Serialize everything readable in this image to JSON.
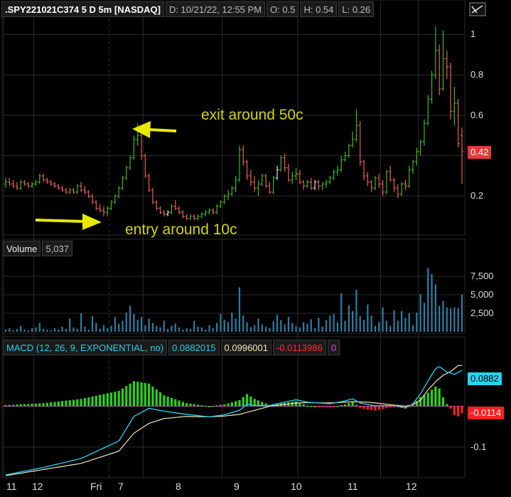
{
  "header": {
    "symbol": ".SPY221021C374 5 D 5m [NASDAQ]",
    "date": "D: 10/21/22, 12:55 PM",
    "open": "O: 0.5",
    "high": "H: 0.54",
    "low": "L: 0.26"
  },
  "annotations": {
    "exit": "exit around 50c",
    "entry": "entry around 10c"
  },
  "price_tag": "0.42",
  "volume_header": {
    "label": "Volume",
    "value": "5,037"
  },
  "macd_header": {
    "label": "MACD (12, 26, 9, EXPONENTIAL, no)",
    "value": "0.0882015",
    "avg": "0.0996001",
    "diff": "-0.0113986",
    "extra": "0"
  },
  "macd_tags": {
    "value": "0.0882",
    "diff": "-0.0114"
  },
  "colors": {
    "up": "#3fb81c",
    "down": "#e5605a",
    "neutral": "#e0e0e0",
    "volume": "#2f7ea3",
    "macd": "#28c8e6",
    "avg": "#f5e6b0",
    "hist_up": "#2cd11e",
    "hist_down": "#ff2020",
    "annotation": "#d4d400",
    "grid": "#2d2d2d",
    "tag_value": "#28d3ee",
    "tag_diff": "#ff2020"
  },
  "x_axis": {
    "ticks": [
      "11",
      "12",
      "Fri",
      "7",
      "8",
      "9",
      "10",
      "11",
      "12"
    ]
  },
  "chart_data": [
    {
      "type": "candlestick",
      "title": ".SPY221021C374 5 D 5m [NASDAQ]",
      "yticks": [
        0.2,
        0.4,
        0.6,
        0.8,
        1.0
      ],
      "ylim": [
        0.05,
        1.1
      ],
      "ohlc": [
        [
          0.26,
          0.29,
          0.24,
          0.27
        ],
        [
          0.27,
          0.29,
          0.25,
          0.26
        ],
        [
          0.26,
          0.28,
          0.24,
          0.25
        ],
        [
          0.25,
          0.27,
          0.23,
          0.24
        ],
        [
          0.24,
          0.28,
          0.23,
          0.27
        ],
        [
          0.27,
          0.28,
          0.25,
          0.26
        ],
        [
          0.26,
          0.27,
          0.24,
          0.25
        ],
        [
          0.25,
          0.27,
          0.24,
          0.26
        ],
        [
          0.26,
          0.28,
          0.25,
          0.27
        ],
        [
          0.27,
          0.31,
          0.26,
          0.3
        ],
        [
          0.3,
          0.31,
          0.27,
          0.28
        ],
        [
          0.28,
          0.29,
          0.26,
          0.27
        ],
        [
          0.27,
          0.28,
          0.25,
          0.26
        ],
        [
          0.26,
          0.27,
          0.24,
          0.25
        ],
        [
          0.25,
          0.26,
          0.23,
          0.24
        ],
        [
          0.24,
          0.25,
          0.22,
          0.23
        ],
        [
          0.23,
          0.24,
          0.21,
          0.22
        ],
        [
          0.22,
          0.24,
          0.21,
          0.23
        ],
        [
          0.23,
          0.24,
          0.21,
          0.22
        ],
        [
          0.22,
          0.26,
          0.21,
          0.25
        ],
        [
          0.25,
          0.27,
          0.22,
          0.23
        ],
        [
          0.23,
          0.25,
          0.21,
          0.22
        ],
        [
          0.22,
          0.23,
          0.19,
          0.2
        ],
        [
          0.2,
          0.21,
          0.16,
          0.17
        ],
        [
          0.17,
          0.18,
          0.13,
          0.14
        ],
        [
          0.14,
          0.16,
          0.12,
          0.13
        ],
        [
          0.13,
          0.15,
          0.1,
          0.12
        ],
        [
          0.12,
          0.15,
          0.1,
          0.14
        ],
        [
          0.14,
          0.18,
          0.13,
          0.17
        ],
        [
          0.17,
          0.21,
          0.16,
          0.2
        ],
        [
          0.2,
          0.25,
          0.19,
          0.24
        ],
        [
          0.24,
          0.3,
          0.23,
          0.29
        ],
        [
          0.29,
          0.35,
          0.28,
          0.34
        ],
        [
          0.34,
          0.4,
          0.33,
          0.39
        ],
        [
          0.39,
          0.5,
          0.38,
          0.48
        ],
        [
          0.48,
          0.56,
          0.45,
          0.5
        ],
        [
          0.5,
          0.52,
          0.38,
          0.4
        ],
        [
          0.4,
          0.41,
          0.29,
          0.3
        ],
        [
          0.3,
          0.31,
          0.22,
          0.23
        ],
        [
          0.23,
          0.24,
          0.16,
          0.17
        ],
        [
          0.17,
          0.18,
          0.13,
          0.14
        ],
        [
          0.14,
          0.15,
          0.11,
          0.12
        ],
        [
          0.12,
          0.13,
          0.1,
          0.11
        ],
        [
          0.11,
          0.13,
          0.1,
          0.12
        ],
        [
          0.12,
          0.16,
          0.11,
          0.15
        ],
        [
          0.15,
          0.18,
          0.13,
          0.14
        ],
        [
          0.14,
          0.15,
          0.11,
          0.12
        ],
        [
          0.12,
          0.13,
          0.09,
          0.1
        ],
        [
          0.1,
          0.11,
          0.08,
          0.09
        ],
        [
          0.09,
          0.11,
          0.08,
          0.1
        ],
        [
          0.1,
          0.11,
          0.08,
          0.09
        ],
        [
          0.09,
          0.11,
          0.08,
          0.1
        ],
        [
          0.1,
          0.12,
          0.09,
          0.11
        ],
        [
          0.11,
          0.13,
          0.1,
          0.12
        ],
        [
          0.12,
          0.14,
          0.11,
          0.13
        ],
        [
          0.13,
          0.14,
          0.11,
          0.12
        ],
        [
          0.12,
          0.16,
          0.11,
          0.15
        ],
        [
          0.15,
          0.18,
          0.14,
          0.17
        ],
        [
          0.17,
          0.21,
          0.16,
          0.2
        ],
        [
          0.2,
          0.23,
          0.18,
          0.21
        ],
        [
          0.21,
          0.25,
          0.2,
          0.24
        ],
        [
          0.24,
          0.3,
          0.22,
          0.28
        ],
        [
          0.28,
          0.45,
          0.27,
          0.43
        ],
        [
          0.43,
          0.45,
          0.35,
          0.37
        ],
        [
          0.37,
          0.38,
          0.28,
          0.3
        ],
        [
          0.3,
          0.33,
          0.25,
          0.27
        ],
        [
          0.27,
          0.3,
          0.22,
          0.24
        ],
        [
          0.24,
          0.28,
          0.2,
          0.26
        ],
        [
          0.26,
          0.31,
          0.25,
          0.3
        ],
        [
          0.3,
          0.31,
          0.24,
          0.25
        ],
        [
          0.25,
          0.27,
          0.21,
          0.22
        ],
        [
          0.22,
          0.3,
          0.21,
          0.29
        ],
        [
          0.29,
          0.35,
          0.28,
          0.33
        ],
        [
          0.33,
          0.4,
          0.32,
          0.39
        ],
        [
          0.39,
          0.41,
          0.32,
          0.34
        ],
        [
          0.34,
          0.36,
          0.27,
          0.28
        ],
        [
          0.28,
          0.32,
          0.26,
          0.3
        ],
        [
          0.3,
          0.34,
          0.28,
          0.31
        ],
        [
          0.31,
          0.33,
          0.26,
          0.27
        ],
        [
          0.27,
          0.28,
          0.23,
          0.25
        ],
        [
          0.25,
          0.28,
          0.24,
          0.27
        ],
        [
          0.27,
          0.29,
          0.23,
          0.24
        ],
        [
          0.24,
          0.28,
          0.23,
          0.27
        ],
        [
          0.27,
          0.28,
          0.23,
          0.25
        ],
        [
          0.25,
          0.27,
          0.23,
          0.26
        ],
        [
          0.26,
          0.28,
          0.24,
          0.27
        ],
        [
          0.27,
          0.3,
          0.26,
          0.29
        ],
        [
          0.29,
          0.33,
          0.28,
          0.32
        ],
        [
          0.32,
          0.35,
          0.3,
          0.33
        ],
        [
          0.33,
          0.4,
          0.32,
          0.38
        ],
        [
          0.38,
          0.42,
          0.37,
          0.4
        ],
        [
          0.4,
          0.46,
          0.39,
          0.45
        ],
        [
          0.45,
          0.52,
          0.44,
          0.48
        ],
        [
          0.48,
          0.63,
          0.47,
          0.55
        ],
        [
          0.55,
          0.57,
          0.35,
          0.37
        ],
        [
          0.37,
          0.38,
          0.28,
          0.3
        ],
        [
          0.3,
          0.32,
          0.25,
          0.27
        ],
        [
          0.27,
          0.28,
          0.22,
          0.24
        ],
        [
          0.24,
          0.3,
          0.23,
          0.29
        ],
        [
          0.29,
          0.31,
          0.24,
          0.26
        ],
        [
          0.26,
          0.28,
          0.2,
          0.22
        ],
        [
          0.22,
          0.33,
          0.21,
          0.32
        ],
        [
          0.32,
          0.35,
          0.27,
          0.28
        ],
        [
          0.28,
          0.29,
          0.22,
          0.24
        ],
        [
          0.24,
          0.26,
          0.19,
          0.21
        ],
        [
          0.21,
          0.27,
          0.2,
          0.26
        ],
        [
          0.26,
          0.28,
          0.23,
          0.25
        ],
        [
          0.25,
          0.35,
          0.24,
          0.33
        ],
        [
          0.33,
          0.38,
          0.31,
          0.37
        ],
        [
          0.37,
          0.44,
          0.35,
          0.42
        ],
        [
          0.42,
          0.48,
          0.4,
          0.47
        ],
        [
          0.47,
          0.58,
          0.45,
          0.56
        ],
        [
          0.56,
          0.7,
          0.55,
          0.68
        ],
        [
          0.68,
          0.82,
          0.66,
          0.8
        ],
        [
          0.8,
          1.04,
          0.78,
          0.92
        ],
        [
          0.92,
          0.95,
          0.7,
          0.73
        ],
        [
          0.73,
          1.02,
          0.72,
          0.88
        ],
        [
          0.88,
          0.92,
          0.78,
          0.84
        ],
        [
          0.84,
          0.86,
          0.58,
          0.62
        ],
        [
          0.62,
          0.74,
          0.55,
          0.66
        ],
        [
          0.66,
          0.68,
          0.44,
          0.46
        ],
        [
          0.5,
          0.54,
          0.26,
          0.42
        ]
      ],
      "colors_override": {
        "43": "neutral",
        "72": "neutral",
        "82": "neutral"
      }
    },
    {
      "type": "bar",
      "title": "Volume",
      "yticks": [
        2500,
        5000,
        7500
      ],
      "ylim": [
        0,
        10000
      ],
      "values": [
        300,
        500,
        200,
        400,
        800,
        300,
        200,
        500,
        600,
        1200,
        400,
        300,
        200,
        500,
        300,
        700,
        400,
        1800,
        600,
        400,
        2500,
        700,
        300,
        2100,
        1200,
        400,
        900,
        500,
        800,
        2000,
        1100,
        1500,
        2600,
        3500,
        2400,
        1600,
        2000,
        900,
        1800,
        1200,
        800,
        600,
        1500,
        400,
        800,
        1100,
        600,
        300,
        500,
        400,
        1500,
        700,
        600,
        300,
        900,
        500,
        1200,
        2400,
        1600,
        1300,
        2600,
        1800,
        6000,
        2200,
        1300,
        600,
        900,
        1800,
        1000,
        700,
        500,
        1400,
        2300,
        1600,
        1000,
        2000,
        1200,
        800,
        600,
        1300,
        1100,
        1700,
        500,
        1900,
        700,
        1600,
        2200,
        2400,
        1300,
        5200,
        1500,
        3600,
        2800,
        5700,
        2100,
        1600,
        3700,
        2200,
        800,
        1300,
        3300,
        1500,
        800,
        2900,
        1500,
        2800,
        1900,
        2500,
        900,
        2600,
        5100,
        3900,
        8600,
        7800,
        6400,
        3500,
        4200,
        3300,
        3200,
        3300,
        3200,
        5037
      ]
    },
    {
      "type": "line",
      "title": "MACD (12, 26, 9, EXPONENTIAL, no)",
      "yticks": [
        -0.1
      ],
      "ylim": [
        -0.17,
        0.13
      ],
      "series": [
        {
          "name": "MACD",
          "anchors": [
            [
              0,
              -0.168
            ],
            [
              10,
              -0.15
            ],
            [
              20,
              -0.128
            ],
            [
              30,
              -0.085
            ],
            [
              34,
              -0.025
            ],
            [
              38,
              -0.005
            ],
            [
              42,
              -0.012
            ],
            [
              48,
              -0.02
            ],
            [
              54,
              -0.026
            ],
            [
              58,
              -0.021
            ],
            [
              62,
              -0.01
            ],
            [
              64,
              0.005
            ],
            [
              66,
              0.002
            ],
            [
              70,
              0.002
            ],
            [
              74,
              0.01
            ],
            [
              77,
              0.016
            ],
            [
              80,
              0.01
            ],
            [
              86,
              0.006
            ],
            [
              90,
              0.013
            ],
            [
              92,
              0.018
            ],
            [
              94,
              0.008
            ],
            [
              98,
              0.001
            ],
            [
              103,
              0.002
            ],
            [
              106,
              -0.004
            ],
            [
              108,
              0.006
            ],
            [
              110,
              0.03
            ],
            [
              112,
              0.062
            ],
            [
              114,
              0.092
            ],
            [
              115,
              0.097
            ],
            [
              117,
              0.084
            ],
            [
              119,
              0.078
            ],
            [
              121,
              0.0882
            ]
          ]
        },
        {
          "name": "Avg",
          "anchors": [
            [
              0,
              -0.17
            ],
            [
              10,
              -0.155
            ],
            [
              20,
              -0.14
            ],
            [
              30,
              -0.11
            ],
            [
              34,
              -0.066
            ],
            [
              38,
              -0.042
            ],
            [
              42,
              -0.03
            ],
            [
              48,
              -0.025
            ],
            [
              54,
              -0.026
            ],
            [
              58,
              -0.024
            ],
            [
              62,
              -0.02
            ],
            [
              66,
              -0.01
            ],
            [
              70,
              0.0
            ],
            [
              77,
              0.008
            ],
            [
              80,
              0.009
            ],
            [
              86,
              0.008
            ],
            [
              92,
              0.011
            ],
            [
              96,
              0.01
            ],
            [
              100,
              0.006
            ],
            [
              104,
              0.002
            ],
            [
              106,
              0.0
            ],
            [
              108,
              0.004
            ],
            [
              110,
              0.015
            ],
            [
              112,
              0.04
            ],
            [
              114,
              0.06
            ],
            [
              116,
              0.076
            ],
            [
              118,
              0.085
            ],
            [
              120,
              0.0996
            ],
            [
              121,
              0.0996
            ]
          ]
        }
      ]
    }
  ]
}
